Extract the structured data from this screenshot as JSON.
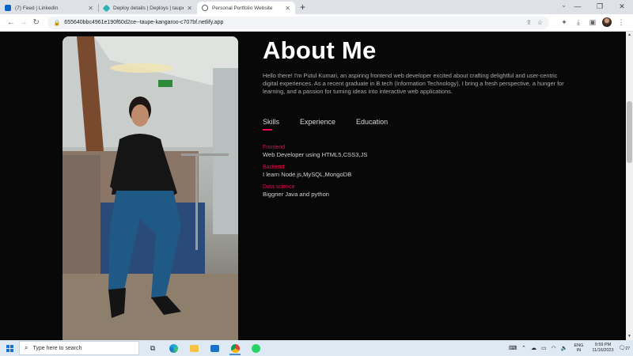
{
  "browser": {
    "tabs": [
      {
        "title": "(7) Feed | LinkedIn",
        "color": "#0a66c2"
      },
      {
        "title": "Deploy details | Deploys | taupe",
        "color": "#2bb2b5"
      },
      {
        "title": "Personal Portfolio Website",
        "color": "#5f6368"
      }
    ],
    "url": "655640bbc4961e190f60d2ce--taupe-kangaroo-c707bf.netlify.app"
  },
  "page": {
    "heading": "About Me",
    "intro": "Hello there! I'm Putul Kumari, an aspiring frontend web developer excited about crafting delightful and user-centric digital experiences. As a recent graduate in B.tech (Information Technology), I bring a fresh perspective, a hunger for learning, and a passion for turning ideas into interactive web applications.",
    "tabs": [
      "Skills",
      "Experience",
      "Education"
    ],
    "accent": "#ff004f",
    "skills": [
      {
        "category": "Frontend",
        "desc": "Web Developer using HTML5,CSS3,JS"
      },
      {
        "category": "Backend",
        "desc": "I learn Node.js,MySQL,MongoDB"
      },
      {
        "category": "Data science",
        "desc": "Biggner Java and python"
      }
    ]
  },
  "taskbar": {
    "search_placeholder": "Type here to search",
    "lang_top": "ENG",
    "lang_bottom": "IN",
    "time": "9:59 PM",
    "date": "11/16/2023",
    "notifications": "27"
  }
}
